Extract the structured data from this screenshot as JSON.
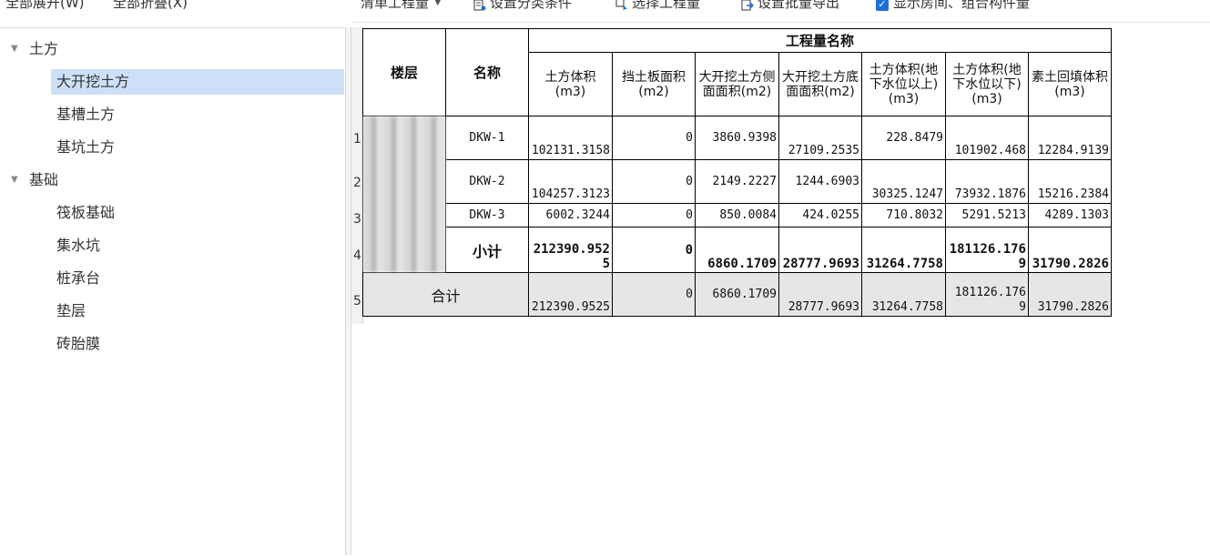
{
  "top_actions": {
    "expand_all": "全部展开(W)",
    "collapse_all": "全部折叠(X)"
  },
  "toolbar": {
    "dropdown_value": "清单工程量",
    "set_category": "设置分类条件",
    "select_quantity": "选择工程量",
    "set_batch_export": "设置批量导出",
    "show_rooms_label": "显示房间、组合构件量",
    "show_rooms_checked": true
  },
  "tree": {
    "groups": [
      {
        "label": "土方",
        "expanded": true,
        "items": [
          "大开挖土方",
          "基槽土方",
          "基坑土方"
        ]
      },
      {
        "label": "基础",
        "expanded": true,
        "items": [
          "筏板基础",
          "集水坑",
          "桩承台",
          "垫层",
          "砖胎膜"
        ]
      }
    ],
    "selected": "大开挖土方"
  },
  "grid": {
    "header_group": "工程量名称",
    "col_floor": "楼层",
    "col_name": "名称",
    "columns": [
      "土方体积(m3)",
      "挡土板面积(m2)",
      "大开挖土方侧面面积(m2)",
      "大开挖土方底面面积(m2)",
      "土方体积(地下水位以上)(m3)",
      "土方体积(地下水位以下)(m3)",
      "素土回填体积(m3)"
    ],
    "row_numbers": [
      "1",
      "2",
      "3",
      "4",
      "5"
    ],
    "rows": [
      {
        "name": "DKW-1",
        "values": [
          "102131.3158",
          "0",
          "3860.9398",
          "27109.2535",
          "228.8479",
          "101902.468",
          "12284.9139"
        ]
      },
      {
        "name": "DKW-2",
        "values": [
          "104257.3123",
          "0",
          "2149.2227",
          "1244.6903",
          "30325.1247",
          "73932.1876",
          "15216.2384"
        ]
      },
      {
        "name": "DKW-3",
        "values": [
          "6002.3244",
          "0",
          "850.0084",
          "424.0255",
          "710.8032",
          "5291.5213",
          "4289.1303"
        ]
      }
    ],
    "subtotal": {
      "name": "小计",
      "values": [
        "212390.9525",
        "0",
        "6860.1709",
        "28777.9693",
        "31264.7758",
        "181126.1769",
        "31790.2826"
      ]
    },
    "total": {
      "name": "合计",
      "values": [
        "212390.9525",
        "0",
        "6860.1709",
        "28777.9693",
        "31264.7758",
        "181126.1769",
        "31790.2826"
      ]
    }
  }
}
